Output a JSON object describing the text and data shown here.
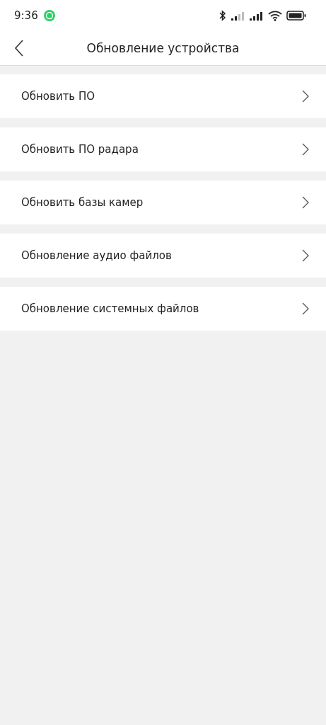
{
  "status_bar": {
    "time": "9:36"
  },
  "header": {
    "title": "Обновление устройства"
  },
  "menu_items": [
    {
      "label": "Обновить ПО"
    },
    {
      "label": "Обновить ПО радара"
    },
    {
      "label": "Обновить базы камер"
    },
    {
      "label": "Обновление аудио файлов"
    },
    {
      "label": "Обновление системных файлов"
    }
  ]
}
